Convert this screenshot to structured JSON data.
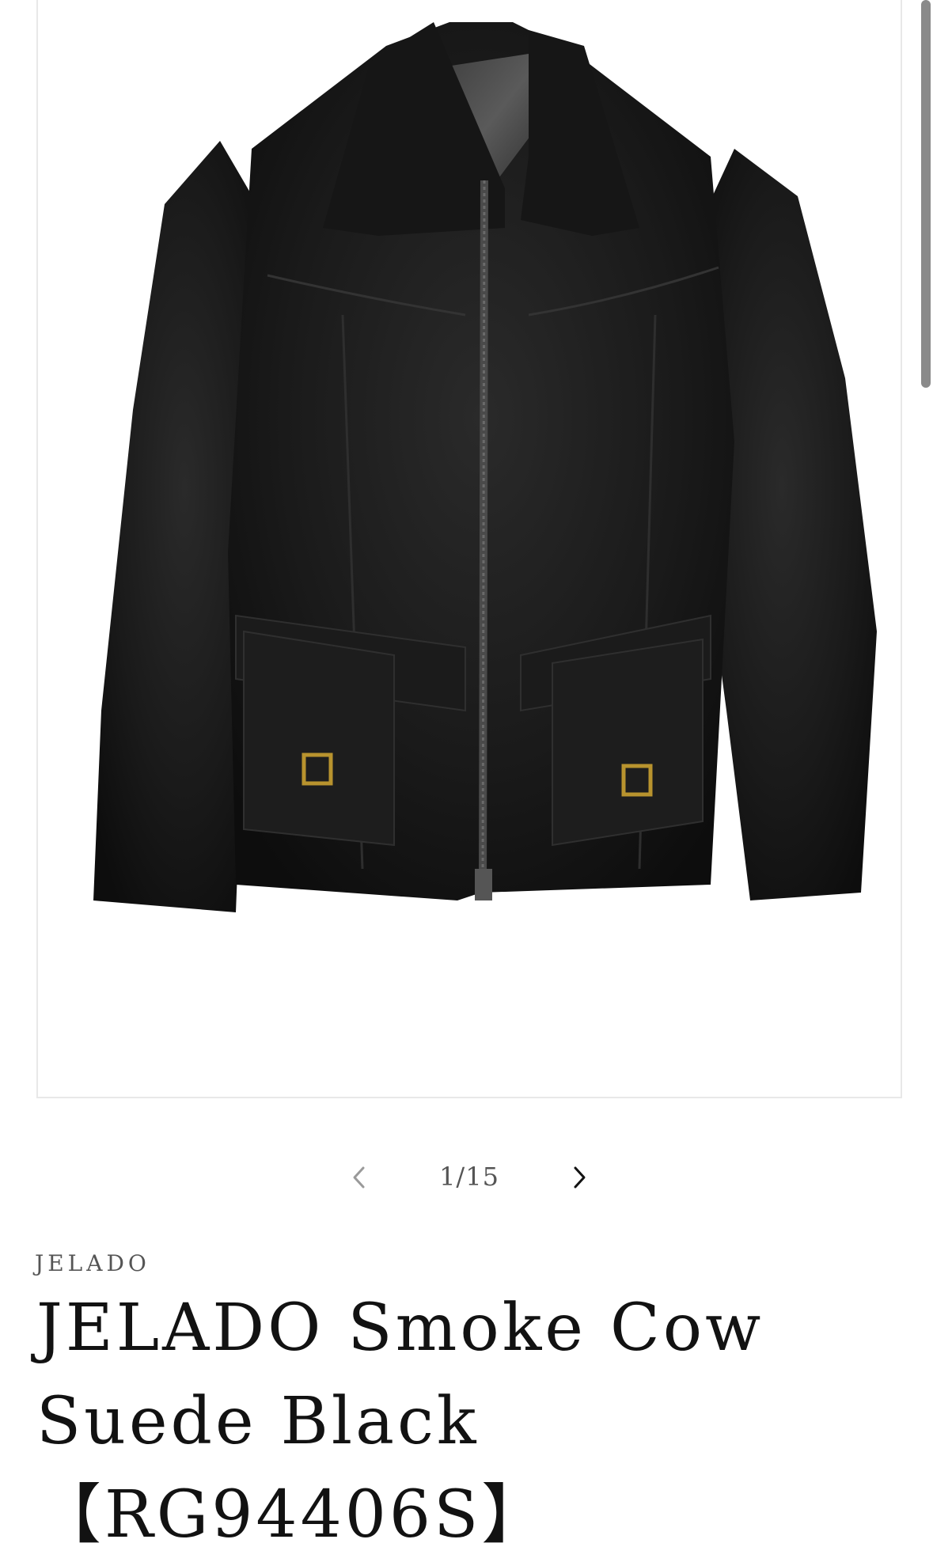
{
  "product": {
    "image_alt": "JELADO Smoke Cow Suede Black jacket",
    "vendor": "JELADO",
    "title": "JELADO Smoke Cow Suede Black 【RG94406S】"
  },
  "slider": {
    "counter": "1/15",
    "prev_icon": "chevron-left-icon",
    "next_icon": "chevron-right-icon"
  }
}
